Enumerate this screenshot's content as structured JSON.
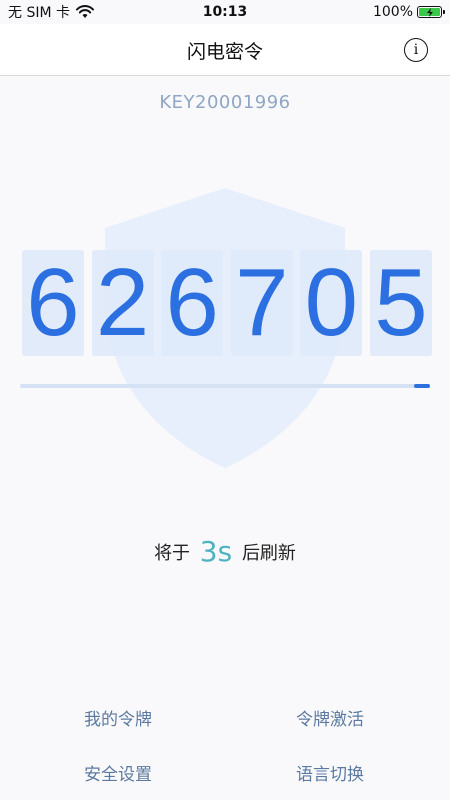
{
  "status_bar": {
    "carrier": "无 SIM 卡",
    "time": "10:13",
    "battery_percent": "100%",
    "battery_level": 1.0
  },
  "header": {
    "title": "闪电密令",
    "info_icon": "info-circle-icon"
  },
  "token": {
    "key_id": "KEY20001996",
    "code_digits": [
      "6",
      "2",
      "6",
      "7",
      "0",
      "5"
    ],
    "remaining_fraction": 0.04
  },
  "refresh": {
    "prefix": "将于",
    "seconds": "3s",
    "suffix": "后刷新"
  },
  "menu": {
    "my_token": "我的令牌",
    "activate_token": "令牌激活",
    "security_settings": "安全设置",
    "language_switch": "语言切换"
  },
  "colors": {
    "accent": "#2b6fe0",
    "countdown": "#4fb2c0",
    "menu_text": "#5c7aa0",
    "battery": "#3ac84a"
  }
}
